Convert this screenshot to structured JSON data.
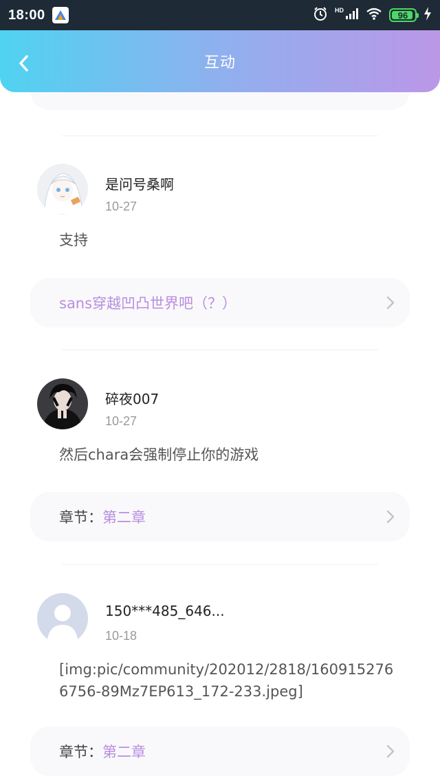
{
  "status_bar": {
    "time": "18:00",
    "hd": "HD",
    "battery": "96"
  },
  "header": {
    "title": "互动"
  },
  "posts": [
    {
      "username": "是问号桑啊",
      "date": "10-27",
      "body": "支持",
      "link": {
        "label": "",
        "value": "sans穿越凹凸世界吧（？）"
      }
    },
    {
      "username": "碎夜007",
      "date": "10-27",
      "body": "然后chara会强制停止你的游戏",
      "link": {
        "label": "章节：",
        "value": "第二章"
      }
    },
    {
      "username": "150***485_646...",
      "date": "10-18",
      "body": "[img:pic/community/202012/2818/1609152766756-89Mz7EP613_172-233.jpeg]",
      "link": {
        "label": "章节：",
        "value": "第二章"
      }
    }
  ],
  "colors": {
    "accent": "#b98de0",
    "header_start": "#4fd3f1",
    "header_end": "#bb97e8"
  }
}
